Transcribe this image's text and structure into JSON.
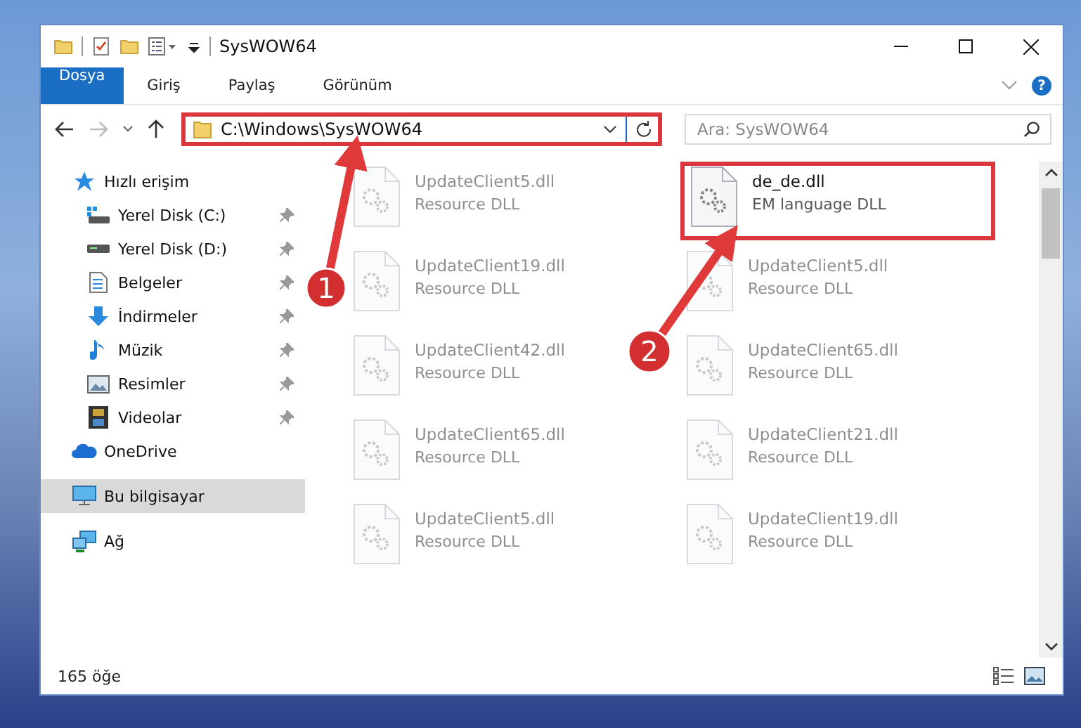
{
  "window": {
    "title": "SysWOW64"
  },
  "ribbon_tabs": [
    {
      "label": "Dosya",
      "kind": "file"
    },
    {
      "label": "Giriş",
      "kind": "tab"
    },
    {
      "label": "Paylaş",
      "kind": "tab"
    },
    {
      "label": "Görünüm",
      "kind": "tab"
    }
  ],
  "help_label": "?",
  "address_bar": {
    "path": "C:\\Windows\\SysWOW64",
    "highlighted": true
  },
  "search": {
    "placeholder": "Ara: SysWOW64"
  },
  "sidebar": {
    "items": [
      {
        "label": "Hızlı erişim",
        "selected": false,
        "children": [
          {
            "label": "Yerel Disk (C:)",
            "pinned": true,
            "selected": false
          },
          {
            "label": "Yerel Disk (D:)",
            "pinned": true,
            "selected": false
          },
          {
            "label": "Belgeler",
            "pinned": true,
            "selected": false
          },
          {
            "label": "İndirmeler",
            "pinned": true,
            "selected": false
          },
          {
            "label": "Müzik",
            "pinned": true,
            "selected": false
          },
          {
            "label": "Resimler",
            "pinned": true,
            "selected": false
          },
          {
            "label": "Videolar",
            "pinned": true,
            "selected": false
          }
        ]
      },
      {
        "label": "OneDrive",
        "selected": false
      },
      {
        "label": "Bu bilgisayar",
        "selected": true
      },
      {
        "label": "Ağ",
        "selected": false
      }
    ]
  },
  "files": [
    {
      "name": "UpdateClient5.dll",
      "type": "Resource DLL",
      "faded": true,
      "highlighted": false
    },
    {
      "name": "de_de.dll",
      "type": "EM language DLL",
      "faded": false,
      "highlighted": true
    },
    {
      "name": "UpdateClient19.dll",
      "type": "Resource DLL",
      "faded": true,
      "highlighted": false
    },
    {
      "name": "UpdateClient5.dll",
      "type": "Resource DLL",
      "faded": true,
      "highlighted": false
    },
    {
      "name": "UpdateClient42.dll",
      "type": "Resource DLL",
      "faded": true,
      "highlighted": false
    },
    {
      "name": "UpdateClient65.dll",
      "type": "Resource DLL",
      "faded": true,
      "highlighted": false
    },
    {
      "name": "UpdateClient65.dll",
      "type": "Resource DLL",
      "faded": true,
      "highlighted": false
    },
    {
      "name": "UpdateClient21.dll",
      "type": "Resource DLL",
      "faded": true,
      "highlighted": false
    },
    {
      "name": "UpdateClient5.dll",
      "type": "Resource DLL",
      "faded": true,
      "highlighted": false
    },
    {
      "name": "UpdateClient19.dll",
      "type": "Resource DLL",
      "faded": true,
      "highlighted": false
    }
  ],
  "annotations": [
    {
      "label": "1"
    },
    {
      "label": "2"
    }
  ],
  "status_bar": {
    "item_count": "165 öğe"
  }
}
